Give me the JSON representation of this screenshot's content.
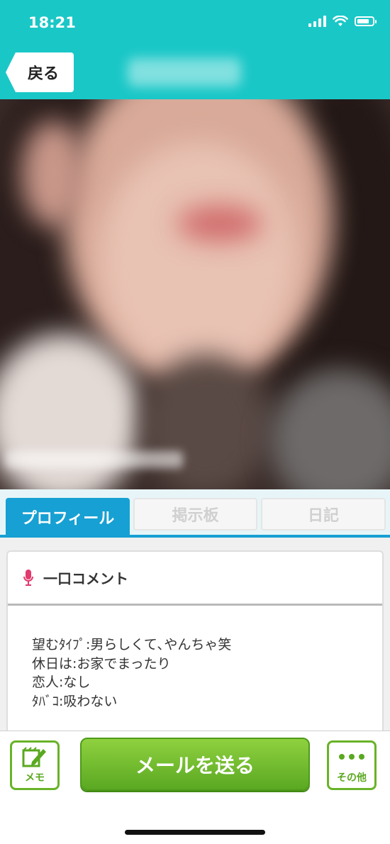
{
  "status_bar": {
    "time": "18:21"
  },
  "header": {
    "back_label": "戻る"
  },
  "tabs": [
    {
      "label": "プロフィール",
      "active": true
    },
    {
      "label": "掲示板",
      "active": false
    },
    {
      "label": "日記",
      "active": false
    }
  ],
  "comment_section": {
    "icon": "mic-icon",
    "title": "一口コメント",
    "lines": [
      "望むﾀｲﾌﾟ:男らしくて､やんちゃ笑",
      "休日は:お家でまったり",
      "恋人:なし",
      "ﾀﾊﾞｺ:吸わない"
    ]
  },
  "bottom_bar": {
    "memo_label": "メモ",
    "send_label": "メールを送る",
    "other_label": "その他"
  },
  "colors": {
    "header_bg": "#1ac7c7",
    "tab_active": "#17a0d3",
    "send_button": "#6bbb2a",
    "mic_icon": "#e23a6e"
  }
}
